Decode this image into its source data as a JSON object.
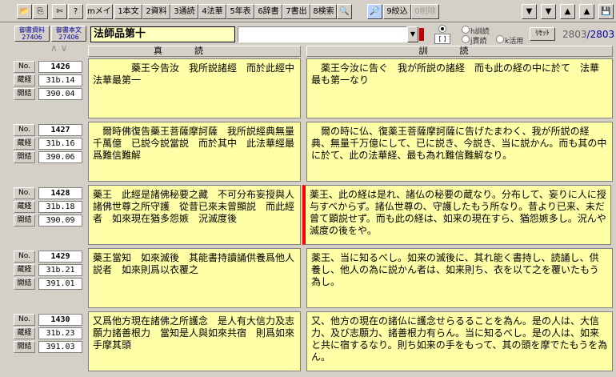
{
  "toolbar": {
    "buttons": [
      {
        "label": "mメイン"
      },
      {
        "label": "1本文"
      },
      {
        "label": "2資料"
      },
      {
        "label": "3通読"
      },
      {
        "label": "4法華"
      },
      {
        "label": "5年表"
      },
      {
        "label": "6辞書"
      },
      {
        "label": "7書出"
      },
      {
        "label": "8検索"
      },
      {
        "label": "9絞込"
      },
      {
        "label": "0削除"
      }
    ]
  },
  "header": {
    "ref_button_1": {
      "line1": "御書資料",
      "line2": "27406"
    },
    "ref_button_2": {
      "line1": "御書本文",
      "line2": "27406"
    },
    "chapter_title": "法師品第十",
    "search_value": "",
    "radio_labels": {
      "kundoku": "h訓読",
      "toku": "j貫読",
      "katsuyo": "k活用"
    },
    "reset_label": "ﾘｾｯﾄ",
    "counter_current": "2803",
    "counter_total": "/2803"
  },
  "columns": {
    "left": "真読",
    "right": "訓読"
  },
  "meta_labels": {
    "no": "No.",
    "zokyo": "蔵経",
    "kaiketsu": "開結"
  },
  "rows": [
    {
      "no": "1426",
      "zokyo": "31b.14",
      "kaiketsu": "390.04",
      "shindoku": "　　　　藥王今告汝　我所説諸經　而於此經中　　　　法華最第一",
      "kundoku": "　薬王今汝に告ぐ　我が所説の諸経　而も此の経の中に於て　法華最も第一なり"
    },
    {
      "no": "1427",
      "zokyo": "31b.16",
      "kaiketsu": "390.06",
      "shindoku": "　爾時佛復告藥王菩薩摩訶薩　我所説經典無量千萬億　已説今説當説　而於其中　此法華經最爲難信難解",
      "kundoku": "　爾の時に仏、復薬王菩薩摩訶薩に告げたまわく、我が所説の経典、無量千万億にして、已に説き、今説き、当に説かん。而も其の中に於て、此の法華経、最も為れ難信難解なり。"
    },
    {
      "no": "1428",
      "zokyo": "31b.18",
      "kaiketsu": "390.09",
      "shindoku": "藥王　此經是諸佛秘要之藏　不可分布妄授與人　諸佛世尊之所守護　從昔已來未曾顯説　而此經者　如來現在猶多怨嫉　況滅度後",
      "kundoku": "薬王、此の経は是れ、諸仏の秘要の蔵なり。分布して、妄りに人に授与すべからず。諸仏世尊の、守護したもう所なり。昔より已来、未だ曾て顕説せず。而も此の経は、如来の現在すら、猶怨嫉多し。況んや滅度の後をや。"
    },
    {
      "no": "1429",
      "zokyo": "31b.21",
      "kaiketsu": "391.01",
      "shindoku": "藥王當知　如來滅後　其能書持讀誦供養爲他人説者　如來則爲以衣覆之",
      "kundoku": "薬王、当に知るべし。如来の滅後に、其れ能く書持し、読誦し、供養し、他人の為に説かん者は、如来則ち、衣を以て之を覆いたもう為し。"
    },
    {
      "no": "1430",
      "zokyo": "31b.23",
      "kaiketsu": "391.03",
      "shindoku": "又爲他方現在諸佛之所護念　是人有大信力及志願力諸善根力　當知是人與如來共宿　則爲如來手摩其頭",
      "kundoku": "又、他方の現在の諸仏に護念せらるることを為ん。是の人は、大信力、及び志願力、諸善根力有らん。当に知るべし。是の人は、如来と共に宿するなり。則ち如来の手をもって、其の頭を摩でたもうを為ん。"
    }
  ],
  "colors": {
    "text_bg": "#ffffa8",
    "title_bg": "#ffffc0",
    "highlight": "#ff0000",
    "counter": "#0000a0"
  }
}
